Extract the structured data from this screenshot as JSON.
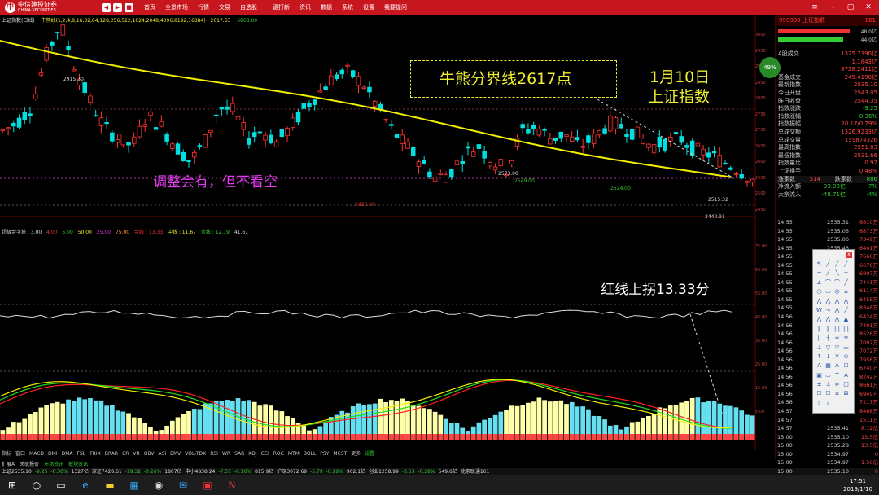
{
  "app": {
    "brand": "中信建投证券",
    "brand_en": "CHINA SECURITIES",
    "menu": [
      "首页",
      "全景市场",
      "行情",
      "交易",
      "自选股",
      "一键打新",
      "资讯",
      "数据",
      "系统",
      "设置",
      "我要提问"
    ]
  },
  "main_panel": {
    "title": "上证指数(日线)",
    "ma_label": "牛熊线(1,2,4,8,16,32,64,128,256,512,1024,2048,4096,8192,16384) : 2617.63",
    "ma_extra": "6863.00"
  },
  "indicator_panel": {
    "title": "超级金字塔 : 3.00",
    "vals": [
      "4.00",
      "5.00",
      "50.00",
      "25.00",
      "75.00",
      "金线 : 13.33",
      "中线 : 11.67",
      "蓝线 : 12.19",
      "41.61"
    ]
  },
  "annotations": {
    "bull_bear": "牛熊分界线2617点",
    "date": "1月10日",
    "index": "上证指数",
    "adjust": "调整会有，但不看空",
    "red_line": "红线上拐13.33分"
  },
  "chart_labels": {
    "high": "2915.30",
    "p2573": "2573.00",
    "p2549": "2549.00",
    "p2524": "2524.00",
    "p2423": "2423.00",
    "low": "2440.91",
    "cur": "2515.32",
    "cur2": "2515.5"
  },
  "price_axis": [
    "3000",
    "2950",
    "2900",
    "2850",
    "2800",
    "2750",
    "2700",
    "2650",
    "2600",
    "2550",
    "2500",
    "2450"
  ],
  "ind_axis": [
    "75.00",
    "65.00",
    "55.00",
    "45.00",
    "35.00",
    "25.00",
    "15.00",
    "5.00"
  ],
  "right": {
    "head": "999999 上证指数",
    "head_extra": "161",
    "bar_vals": [
      "48.0亿",
      "44.0亿"
    ],
    "rows": [
      [
        "A股成交",
        "1325.7390亿",
        ""
      ],
      [
        "",
        "1.1843亿",
        ""
      ],
      [
        "",
        "8728.2411亿",
        ""
      ],
      [
        "基金成交",
        "245.4190亿",
        ""
      ],
      [
        "最新指数",
        "2535.10",
        ""
      ],
      [
        "今日开盘",
        "2543.05",
        ""
      ],
      [
        "昨日收盘",
        "2544.35",
        ""
      ],
      [
        "指数涨跌",
        "-9.25",
        "g"
      ],
      [
        "指数涨幅",
        "-0.36%",
        "g"
      ],
      [
        "指数振幅",
        "20.17/0.79%",
        ""
      ],
      [
        "总成交额",
        "1326.9233亿",
        ""
      ],
      [
        "总成交量",
        "159874326",
        ""
      ],
      [
        "最高指数",
        "2551.83",
        ""
      ],
      [
        "最低指数",
        "2531.66",
        ""
      ],
      [
        "指数量比",
        "0.97",
        ""
      ],
      [
        "上证换手",
        "0.48%",
        ""
      ]
    ],
    "updown": {
      "up_label": "涨家数",
      "up": "514",
      "down_label": "跌家数",
      "down": "886"
    },
    "flows": [
      [
        "净流入额",
        "-93.93亿",
        "-7%"
      ],
      [
        "大宗流入",
        "-48.71亿",
        "-4%"
      ]
    ],
    "gauge": "49%",
    "ticks": [
      [
        "14:55",
        "2535.31",
        "6810万"
      ],
      [
        "14:55",
        "2535.03",
        "6873万"
      ],
      [
        "14:55",
        "2535.06",
        "7349万"
      ],
      [
        "14:55",
        "2535.43",
        "6401万"
      ],
      [
        "14:55",
        "",
        "7666万"
      ],
      [
        "14:55",
        "",
        "6678万"
      ],
      [
        "14:55",
        "",
        "6907万"
      ],
      [
        "14:55",
        "",
        "7441万"
      ],
      [
        "14:55",
        "",
        "6114万"
      ],
      [
        "14:55",
        "",
        "6455万"
      ],
      [
        "14:55",
        "",
        "8348万"
      ],
      [
        "14:56",
        "",
        "6424万"
      ],
      [
        "14:56",
        "",
        "7491万"
      ],
      [
        "14:56",
        "",
        "8526万"
      ],
      [
        "14:56",
        "",
        "7097万"
      ],
      [
        "14:56",
        "",
        "7072万"
      ],
      [
        "14:56",
        "",
        "7956万"
      ],
      [
        "14:56",
        "",
        "6740万"
      ],
      [
        "14:56",
        "",
        "8242万"
      ],
      [
        "14:56",
        "",
        "8661万"
      ],
      [
        "14:56",
        "",
        "6949万"
      ],
      [
        "14:56",
        "",
        "7217万"
      ],
      [
        "14:57",
        "",
        "8468万"
      ],
      [
        "14:57",
        "",
        "1511万"
      ],
      [
        "14:57",
        "2535.41",
        "8.12亿"
      ],
      [
        "15:00",
        "2535.10",
        "13.5亿"
      ],
      [
        "15:00",
        "2535.28",
        "13.5亿"
      ],
      [
        "15:00",
        "2534.97",
        "0"
      ],
      [
        "15:00",
        "2534.97",
        "1.56亿"
      ],
      [
        "15:00",
        "2535.10",
        "0"
      ]
    ]
  },
  "bottom_tabs": [
    "指标",
    "窗口",
    "MACD",
    "DMI",
    "DMA",
    "FSL",
    "TRIX",
    "BRAR",
    "CR",
    "VR",
    "OBV",
    "ASI",
    "EMV",
    "VOL-TDX",
    "RSI",
    "WR",
    "SAR",
    "KDJ",
    "CCI",
    "ROC",
    "MTM",
    "BOLL",
    "PSY",
    "MCST",
    "更多",
    "设置"
  ],
  "info_tabs": [
    "扩展A",
    "关联报价",
    "市场资讯",
    "板块资讯"
  ],
  "index_bar": [
    {
      "name": "上证",
      "val": "2535.10",
      "chg": "-9.25",
      "pct": "-0.36%",
      "amt": "1327亿",
      "c": "g"
    },
    {
      "name": "深证",
      "val": "7428.61",
      "chg": "-19.32",
      "pct": "-0.26%",
      "amt": "1807亿",
      "c": "g"
    },
    {
      "name": "中小",
      "val": "4838.24",
      "chg": "-7.55",
      "pct": "-0.16%",
      "amt": "815.9亿",
      "c": "g"
    },
    {
      "name": "沪深",
      "val": "3072.69",
      "chg": "-5.79",
      "pct": "-0.19%",
      "amt": "902.1亿",
      "c": "g"
    },
    {
      "name": "创业",
      "val": "1258.99",
      "chg": "-3.53",
      "pct": "-0.28%",
      "amt": "549.6亿",
      "c": "g"
    }
  ],
  "index_bar_extra": "北京联通161",
  "taskbar": {
    "time": "17:51",
    "date": "2019/1/10"
  },
  "colors": {
    "up": "#ff3333",
    "down": "#00e0e0",
    "ma": "#f0f000",
    "accent": "#c8161e"
  }
}
